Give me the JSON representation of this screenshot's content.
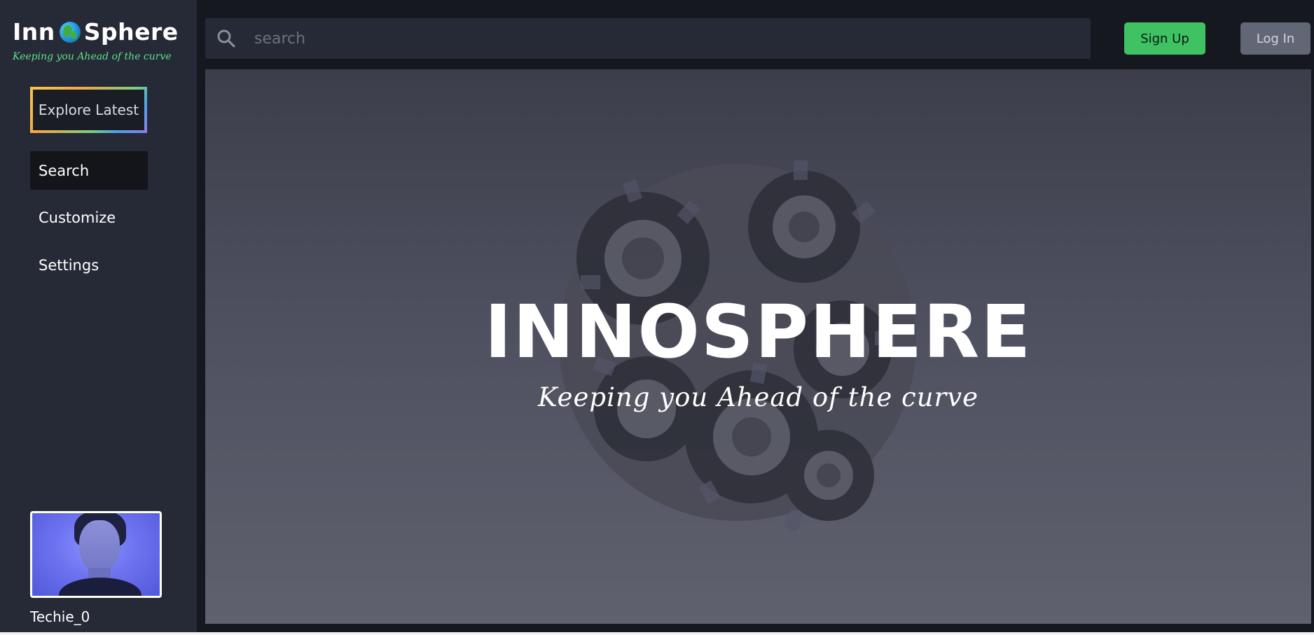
{
  "app": {
    "logo_part1": "Inn",
    "logo_globe": "globe-icon",
    "logo_part2": "Sphere",
    "tagline": "Keeping you Ahead of the curve"
  },
  "sidebar": {
    "explore_label": "Explore Latest",
    "items": [
      {
        "label": "Search",
        "active": true
      },
      {
        "label": "Customize",
        "active": false
      },
      {
        "label": "Settings",
        "active": false
      }
    ],
    "user": {
      "avatar": "user-avatar",
      "username": "Techie_0"
    }
  },
  "header": {
    "search_icon": "search-icon",
    "search_placeholder": "search",
    "signup_label": "Sign Up",
    "login_label": "Log In"
  },
  "hero": {
    "title": "INNOSPHERE",
    "subtitle": "Keeping you Ahead of the curve",
    "background": "gears-sphere-illustration"
  },
  "colors": {
    "sidebar_bg": "#262a36",
    "page_bg": "#16181f",
    "signup_green": "#3ec262",
    "login_gray": "#626776",
    "tagline_green": "#5fe08a"
  }
}
